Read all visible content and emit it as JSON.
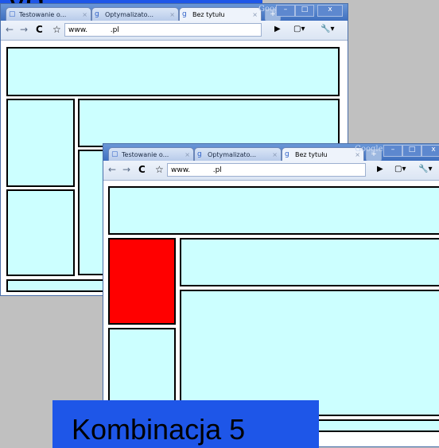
{
  "slide": {
    "top_heading_fragment": "yg",
    "caption": "Kombinacja 5"
  },
  "browser": {
    "brand": "Google",
    "window_controls": {
      "minimize": "–",
      "maximize": "□",
      "close": "x"
    },
    "tabs": [
      {
        "label": "Testowanie o...",
        "icon": "page-icon",
        "active": false
      },
      {
        "label": "Optymalizato...",
        "icon": "google-g-icon",
        "active": false
      },
      {
        "label": "Bez tytułu",
        "icon": "google-g-icon",
        "active": true
      }
    ],
    "new_tab_label": "+",
    "toolbar": {
      "back": "←",
      "forward": "→",
      "reload": "C",
      "star": "☆",
      "url": "www.          .pl",
      "go": "▶",
      "page_menu": "▢▾",
      "tools_menu": "🔧▾"
    }
  },
  "colors": {
    "block_fill": "#ccffff",
    "highlight_block": "#ff0000",
    "caption_bg": "#1e56e8",
    "slide_bg": "#c0c0c0"
  }
}
